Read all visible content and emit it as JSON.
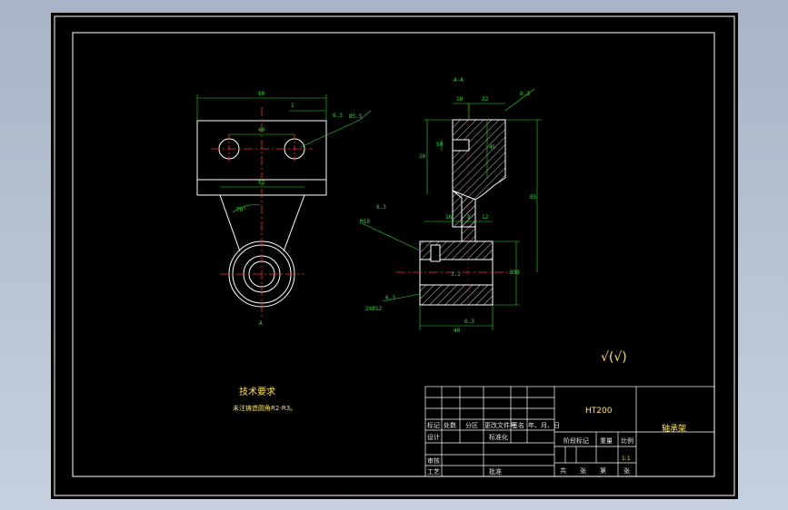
{
  "section_label": "A-A",
  "view_arrow_label": "A",
  "dimensions": {
    "top_width": "80",
    "hole_spacing": "40",
    "inner_width": "52",
    "angle": "70°",
    "marker_1": "1",
    "sec_10": "10",
    "sec_22": "22",
    "sec_16": "16",
    "sec_45": "45",
    "sec_50": "50",
    "sec_85": "85",
    "sec_16b": "16",
    "sec_8": "8",
    "sec_12": "12",
    "sec_bottom": "40",
    "sec_dia": "Ø38",
    "rough_1": "6.3",
    "rough_2": "6.3",
    "rough_3": "6.3",
    "rough_4": "6.3",
    "rough_5": "3.2",
    "rough_6": "6.3",
    "hole_callout_1": "Ø5.5",
    "hole_callout_2": "M10",
    "hole_callout_3": "2XØ12"
  },
  "tech_req": {
    "title": "技术要求",
    "text": "未注铸造圆角R2-R3。"
  },
  "roughness_symbol": "√(√)",
  "title_block": {
    "material": "HT200",
    "part_name": "轴承架",
    "scale_value": "1:1",
    "scale_label": "比例",
    "weight_label": "重量",
    "stage_label": "阶段标记",
    "design": "设计",
    "standard": "标准化",
    "review": "审核",
    "process": "工艺",
    "approve": "批准",
    "mark": "标记",
    "count": "处数",
    "zone": "分区",
    "change_doc": "更改文件号",
    "sign": "签名",
    "date": "年、月、日",
    "sheet_total": "共",
    "sheet_label": "张",
    "sheet_no": "第",
    "sheet_label2": "张"
  },
  "colors": {
    "background": "#000000",
    "outline": "#ffffff",
    "dimension": "#22e122",
    "center_line": "#ff2a2a",
    "annotation": "#ffe34d"
  }
}
